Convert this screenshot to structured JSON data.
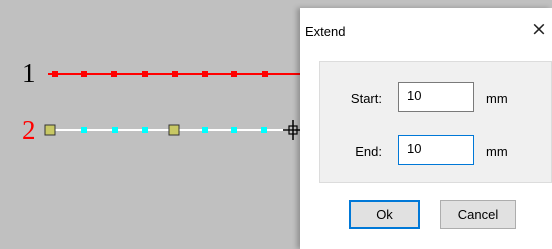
{
  "canvas": {
    "background": "#c0c0c0",
    "line1": {
      "label": "1",
      "label_color": "#000000",
      "color": "#ff0000",
      "marker_color": "#ff0000"
    },
    "line2": {
      "label": "2",
      "label_color": "#ff0000",
      "color": "#ffffff",
      "marker_color": "#00ffff",
      "handle_color": "#c8c864"
    },
    "cursor": "crosshair-move-icon"
  },
  "dialog": {
    "title": "Extend",
    "close_glyph": "×",
    "start": {
      "label": "Start:",
      "value": "10",
      "unit": "mm"
    },
    "end": {
      "label": "End:",
      "value": "10",
      "unit": "mm"
    },
    "ok_label": "Ok",
    "cancel_label": "Cancel",
    "accent": "#0078d7"
  }
}
